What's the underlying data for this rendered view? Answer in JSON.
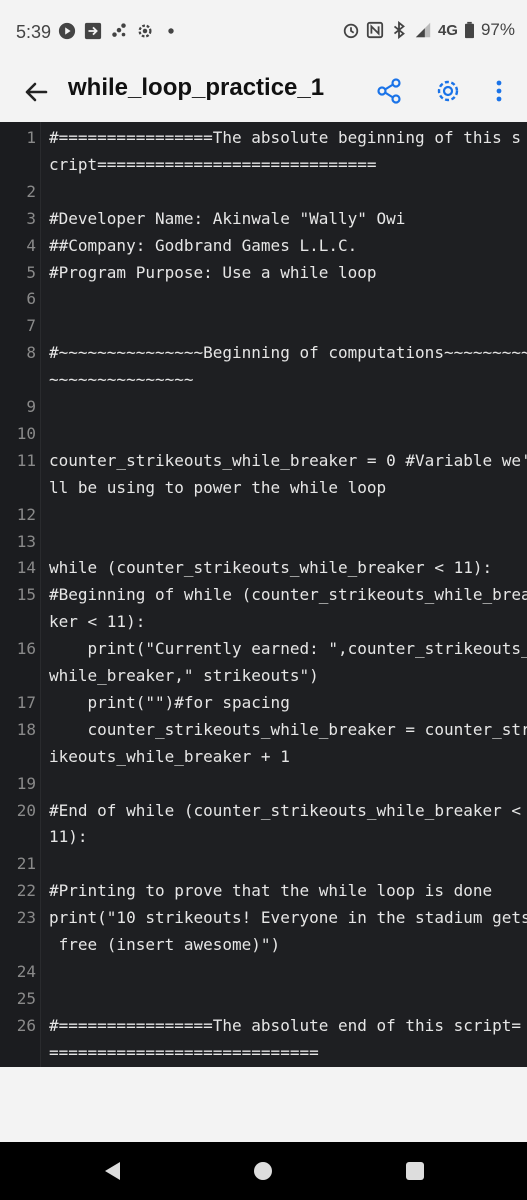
{
  "status_bar": {
    "time": "5:39",
    "network": "4G",
    "battery": "97%",
    "left_icons": [
      "play-icon",
      "forward-icon",
      "apps-icon",
      "gear-icon",
      "dot-icon"
    ],
    "right_icons": [
      "alarm-icon",
      "nfc-icon",
      "bluetooth-icon",
      "signal-icon",
      "battery-icon"
    ]
  },
  "appbar": {
    "title": "while_loop_practice_1",
    "actions": [
      "share-icon",
      "settings-icon",
      "more-icon"
    ],
    "accent": "#1a73e8"
  },
  "code_rows": [
    {
      "n": "1",
      "text": "#================The absolute beginning of this s"
    },
    {
      "n": "",
      "text": "cript============================="
    },
    {
      "n": "2",
      "text": ""
    },
    {
      "n": "3",
      "text": "#Developer Name: Akinwale \"Wally\" Owi"
    },
    {
      "n": "4",
      "text": "##Company: Godbrand Games L.L.C."
    },
    {
      "n": "5",
      "text": "#Program Purpose: Use a while loop"
    },
    {
      "n": "6",
      "text": ""
    },
    {
      "n": "7",
      "text": ""
    },
    {
      "n": "8",
      "text": "#~~~~~~~~~~~~~~~Beginning of computations~~~~~~~~~"
    },
    {
      "n": "",
      "text": "~~~~~~~~~~~~~~~"
    },
    {
      "n": "9",
      "text": ""
    },
    {
      "n": "10",
      "text": ""
    },
    {
      "n": "11",
      "text": "counter_strikeouts_while_breaker = 0 #Variable we'"
    },
    {
      "n": "",
      "text": "ll be using to power the while loop"
    },
    {
      "n": "12",
      "text": ""
    },
    {
      "n": "13",
      "text": ""
    },
    {
      "n": "14",
      "text": "while (counter_strikeouts_while_breaker < 11):"
    },
    {
      "n": "15",
      "text": "#Beginning of while (counter_strikeouts_while_brea"
    },
    {
      "n": "",
      "text": "ker < 11):"
    },
    {
      "n": "16",
      "text": "    print(\"Currently earned: \",counter_strikeouts_"
    },
    {
      "n": "",
      "text": "while_breaker,\" strikeouts\")"
    },
    {
      "n": "17",
      "text": "    print(\"\")#for spacing"
    },
    {
      "n": "18",
      "text": "    counter_strikeouts_while_breaker = counter_str"
    },
    {
      "n": "",
      "text": "ikeouts_while_breaker + 1"
    },
    {
      "n": "19",
      "text": ""
    },
    {
      "n": "20",
      "text": "#End of while (counter_strikeouts_while_breaker <"
    },
    {
      "n": "",
      "text": "11):"
    },
    {
      "n": "21",
      "text": ""
    },
    {
      "n": "22",
      "text": "#Printing to prove that the while loop is done"
    },
    {
      "n": "23",
      "text": "print(\"10 strikeouts! Everyone in the stadium gets"
    },
    {
      "n": "",
      "text": " free (insert awesome)\")"
    },
    {
      "n": "24",
      "text": ""
    },
    {
      "n": "25",
      "text": ""
    },
    {
      "n": "26",
      "text": "#================The absolute end of this script="
    },
    {
      "n": "",
      "text": "============================"
    }
  ],
  "nav_bar": [
    "back-icon",
    "home-icon",
    "recents-icon"
  ]
}
